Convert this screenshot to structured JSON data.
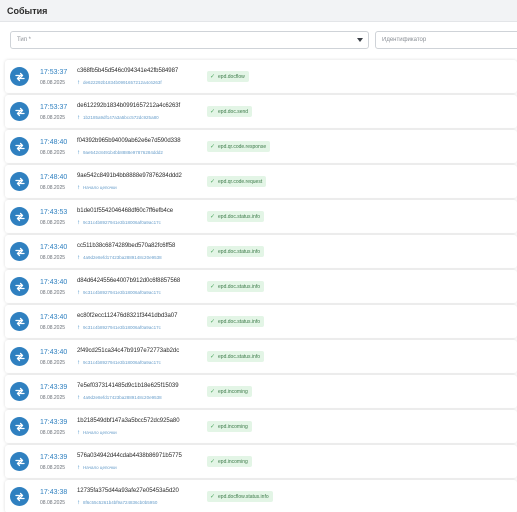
{
  "header": {
    "title": "События"
  },
  "filters": {
    "type_placeholder": "Тип *",
    "identifier_placeholder": "Идентификатор"
  },
  "events": [
    {
      "time": "17:53:37",
      "date": "08.08.2025",
      "id": "c368fb5b45d546c094341e42fb584987",
      "sub": "de622292b1834b0991657212a4c6263f",
      "tag": "epd.docflow"
    },
    {
      "time": "17:53:37",
      "date": "08.08.2025",
      "id": "de612292b1834b0991657212a4c6263f",
      "sub": "1b2185a9df147a3a5bcc572dc925a80",
      "tag": "epd.doc.send"
    },
    {
      "time": "17:48:40",
      "date": "08.08.2025",
      "id": "f04392b965b94009ab62e6e7d590d338",
      "sub": "9ae542c8491b4bb8888e97876284ddd2",
      "tag": "epd.qr.code.response"
    },
    {
      "time": "17:48:40",
      "date": "08.08.2025",
      "id": "9ae542c8491b4bb8888e97876284ddd2",
      "sub": "Начало цепочки",
      "tag": "epd.qr.code.request"
    },
    {
      "time": "17:43:53",
      "date": "08.08.2025",
      "id": "b1de01f5542046468df60c7ff6efb4ce",
      "sub": "9c31c4b8927941e3b18006af0a9ac17c",
      "tag": "epd.doc.status.info"
    },
    {
      "time": "17:43:40",
      "date": "08.08.2025",
      "id": "cc511b38c6874289bed570a82fc6ff58",
      "sub": "4a9d2e8efd17423ba2889148c20e9538",
      "tag": "epd.doc.status.info"
    },
    {
      "time": "17:43:40",
      "date": "08.08.2025",
      "id": "d84d6424556e4007b912d0c6f8857568",
      "sub": "9c31c4b8927941e3b18006af0a9ac17c",
      "tag": "epd.doc.status.info"
    },
    {
      "time": "17:43:40",
      "date": "08.08.2025",
      "id": "ec80f2ecc112476d8321f3441dbd3a07",
      "sub": "9c31c4b8927941e3b18006af0a9ac17c",
      "tag": "epd.doc.status.info"
    },
    {
      "time": "17:43:40",
      "date": "08.08.2025",
      "id": "2f49cd251ca34c47b9197e72773ab2dc",
      "sub": "9c31c4b8927941e3b18006af0a9ac17c",
      "tag": "epd.doc.status.info"
    },
    {
      "time": "17:43:39",
      "date": "08.08.2025",
      "id": "7e5ef0373141485d9c1b18e625f15039",
      "sub": "4a9d2e8efd17423ba2889148c20e9538",
      "tag": "epd.incoming"
    },
    {
      "time": "17:43:39",
      "date": "08.08.2025",
      "id": "1b218549dbf147a3a5bcc572dc925a80",
      "sub": "Начало цепочки",
      "tag": "epd.incoming"
    },
    {
      "time": "17:43:39",
      "date": "08.08.2025",
      "id": "576a034942d44cdab4438b86971b5775",
      "sub": "Начало цепочки",
      "tag": "epd.incoming"
    },
    {
      "time": "17:43:38",
      "date": "08.08.2025",
      "id": "12735fa375d44a93afe27e05453a5d20",
      "sub": "8f6c55c5261b4bf9a724836cb0b5950",
      "tag": "epd.docflow.status.info"
    }
  ],
  "colors": {
    "accent": "#2f80c0",
    "tag_background": "#e3f5e6",
    "tag_text": "#3c7a49"
  },
  "icons": {
    "event": "link-arrows-icon",
    "tag": "check-icon",
    "sub": "arrow-up-icon"
  }
}
